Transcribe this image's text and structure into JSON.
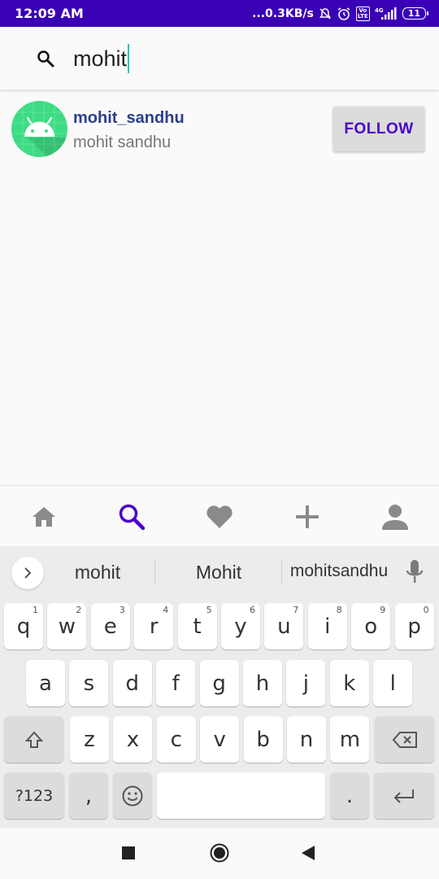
{
  "status_bar": {
    "time": "12:09 AM",
    "network_speed": "...0.3KB/s",
    "battery": "11",
    "lte_label": "Vo\nLTE",
    "signal_label": "4G"
  },
  "search": {
    "query": "mohit"
  },
  "results": [
    {
      "username": "mohit_sandhu",
      "fullname": "mohit sandhu",
      "button_label": "FOLLOW"
    }
  ],
  "bottom_nav": {
    "items": [
      "home-icon",
      "search-icon",
      "heart-icon",
      "add-icon",
      "profile-icon"
    ],
    "active": "search-icon",
    "active_color": "#4b00c8",
    "inactive_color": "#8a8a8a"
  },
  "keyboard": {
    "suggestions": [
      "mohit",
      "Mohit",
      "mohitsandhu"
    ],
    "row1": [
      {
        "key": "q",
        "hint": "1"
      },
      {
        "key": "w",
        "hint": "2"
      },
      {
        "key": "e",
        "hint": "3"
      },
      {
        "key": "r",
        "hint": "4"
      },
      {
        "key": "t",
        "hint": "5"
      },
      {
        "key": "y",
        "hint": "6"
      },
      {
        "key": "u",
        "hint": "7"
      },
      {
        "key": "i",
        "hint": "8"
      },
      {
        "key": "o",
        "hint": "9"
      },
      {
        "key": "p",
        "hint": "0"
      }
    ],
    "row2": [
      "a",
      "s",
      "d",
      "f",
      "g",
      "h",
      "j",
      "k",
      "l"
    ],
    "row3": [
      "z",
      "x",
      "c",
      "v",
      "b",
      "n",
      "m"
    ],
    "symbols_label": "?123",
    "comma_label": ",",
    "period_label": "."
  },
  "colors": {
    "status_bar": "#3a00b5",
    "accent": "#4b00c8",
    "username": "#2c3e8f"
  }
}
